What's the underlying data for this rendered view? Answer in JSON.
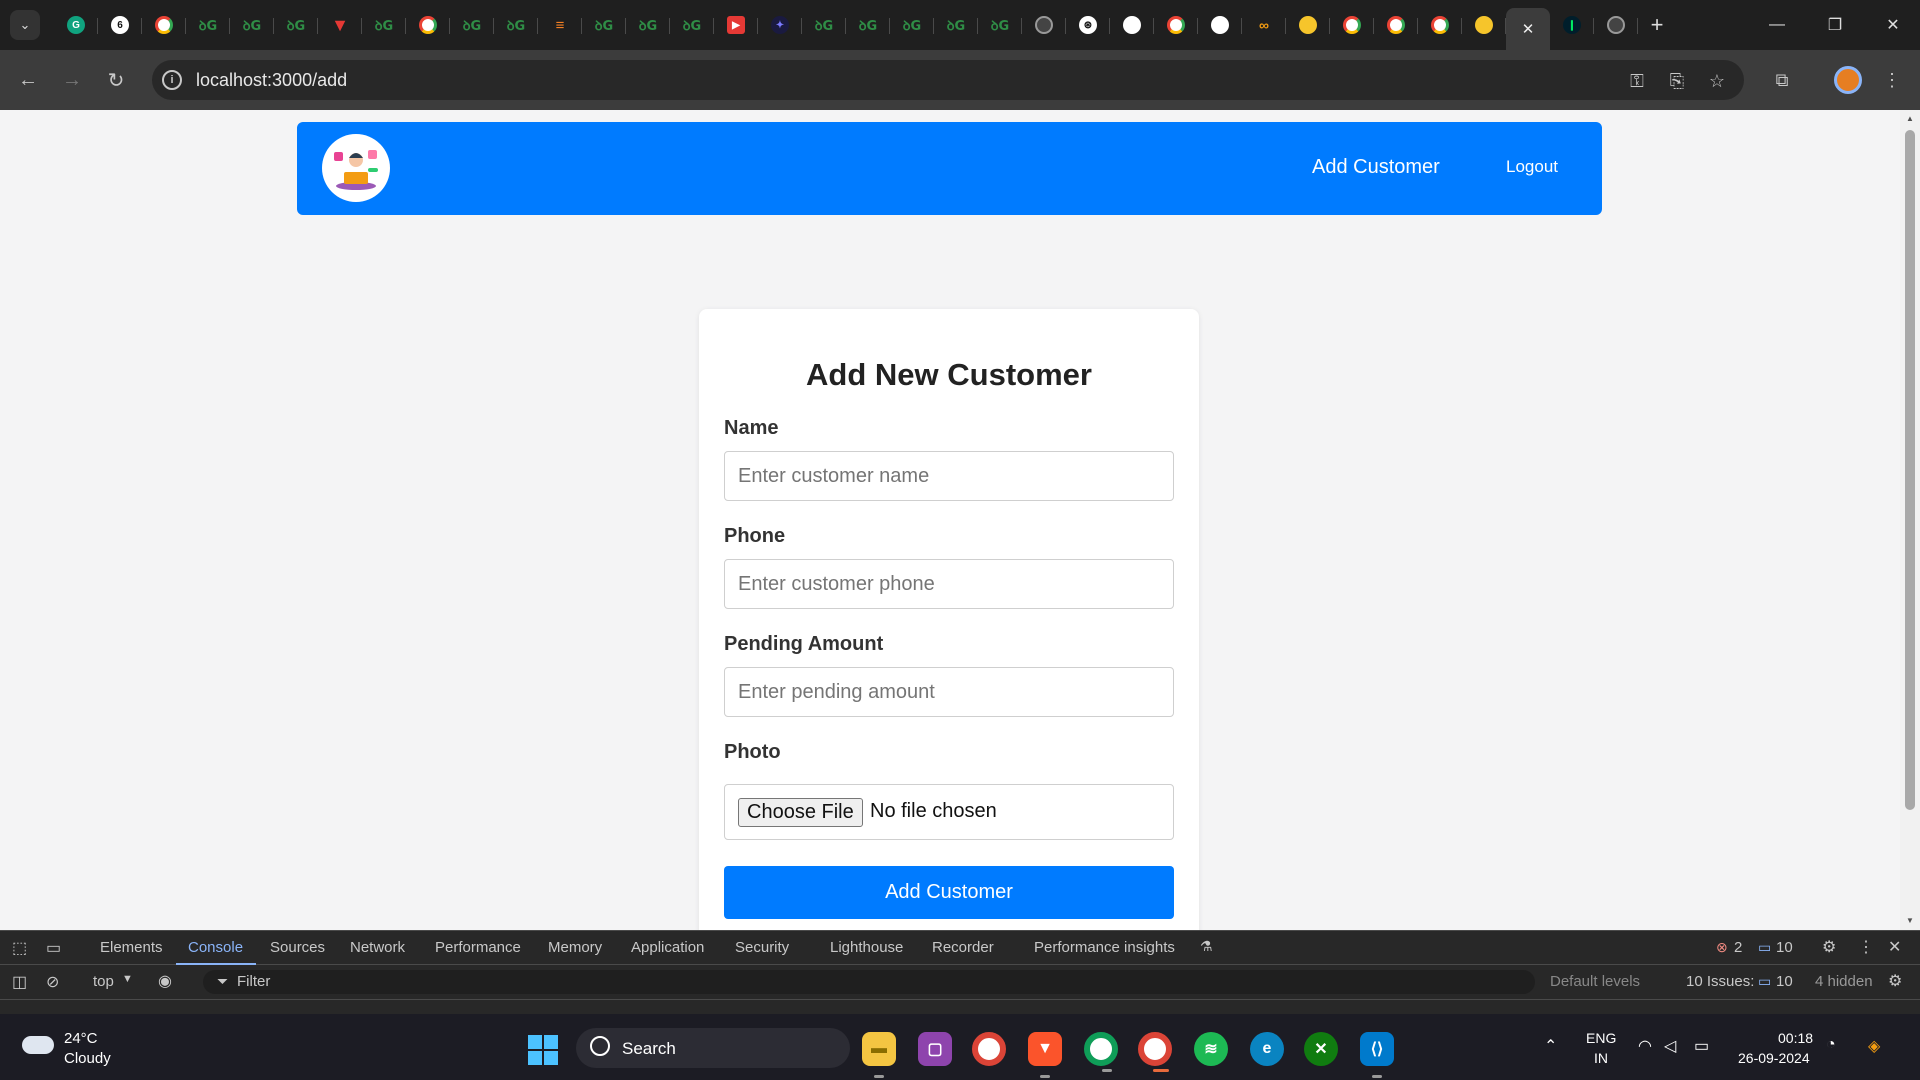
{
  "browser": {
    "url": "localhost:3000/add",
    "tabs": [
      {
        "icon": "grammarly-icon"
      },
      {
        "icon": "chatgpt-icon"
      },
      {
        "icon": "google-icon"
      },
      {
        "icon": "gfg-icon"
      },
      {
        "icon": "gfg-icon"
      },
      {
        "icon": "gfg-icon"
      },
      {
        "icon": "vercel-icon"
      },
      {
        "icon": "gfg-icon"
      },
      {
        "icon": "google-icon"
      },
      {
        "icon": "gfg-icon"
      },
      {
        "icon": "gfg-icon"
      },
      {
        "icon": "stackoverflow-icon"
      },
      {
        "icon": "gfg-icon"
      },
      {
        "icon": "gfg-icon"
      },
      {
        "icon": "gfg-icon"
      },
      {
        "icon": "youtube-icon"
      },
      {
        "icon": "app-icon"
      },
      {
        "icon": "gfg-icon"
      },
      {
        "icon": "gfg-icon"
      },
      {
        "icon": "gfg-icon"
      },
      {
        "icon": "gfg-icon"
      },
      {
        "icon": "gfg-icon"
      },
      {
        "icon": "gfg-icon"
      },
      {
        "icon": "openai-icon"
      },
      {
        "icon": "github-icon"
      },
      {
        "icon": "google-icon"
      },
      {
        "icon": "github-icon"
      },
      {
        "icon": "infinity-icon"
      },
      {
        "icon": "huggingface-icon"
      },
      {
        "icon": "google-icon"
      },
      {
        "icon": "google-icon"
      },
      {
        "icon": "google-icon"
      },
      {
        "icon": "huggingface-icon"
      },
      {
        "icon": "localhost-icon",
        "active": true
      },
      {
        "icon": "mongodb-icon"
      },
      {
        "icon": "chrome-icon"
      }
    ]
  },
  "app": {
    "nav": {
      "add_customer": "Add Customer",
      "logout": "Logout"
    },
    "form": {
      "title": "Add New Customer",
      "name_label": "Name",
      "name_placeholder": "Enter customer name",
      "phone_label": "Phone",
      "phone_placeholder": "Enter customer phone",
      "pending_label": "Pending Amount",
      "pending_placeholder": "Enter pending amount",
      "photo_label": "Photo",
      "file_button": "Choose File",
      "file_status": "No file chosen",
      "submit": "Add Customer"
    },
    "colors": {
      "primary": "#007bff"
    }
  },
  "devtools": {
    "tabs": [
      "Elements",
      "Console",
      "Sources",
      "Network",
      "Performance",
      "Memory",
      "Application",
      "Security",
      "Lighthouse",
      "Recorder",
      "Performance insights"
    ],
    "active_tab": "Console",
    "errors": "2",
    "messages": "10",
    "context": "top",
    "filter": "Filter",
    "levels": "Default levels",
    "issues_label": "10 Issues:",
    "issues_count": "10",
    "hidden": "4 hidden"
  },
  "taskbar": {
    "temperature": "24°C",
    "weather": "Cloudy",
    "search": "Search",
    "lang_1": "ENG",
    "lang_2": "IN",
    "time": "00:18",
    "date": "26-09-2024"
  }
}
